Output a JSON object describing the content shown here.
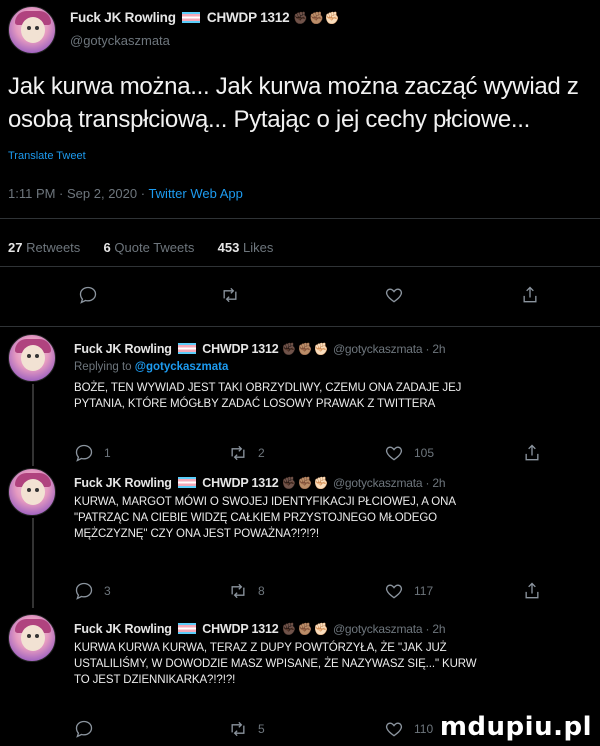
{
  "main_tweet": {
    "author_name": "Fuck JK Rowling",
    "author_suffix": "CHWDP 1312",
    "hands": "✊🏿✊🏽✊🏻",
    "handle": "@gotyckaszmata",
    "text_line1": "Jak kurwa można... Jak kurwa można zacząć wywiad z",
    "text_line2": "osobą transpłciową... Pytając o jej cechy płciowe...",
    "translate_label": "Translate Tweet",
    "timestamp": "1:11 PM · Sep 2, 2020 · ",
    "app": "Twitter Web App",
    "retweets_count": "27",
    "retweets_label": "Retweets",
    "quotes_count": "6",
    "quotes_label": "Quote Tweets",
    "likes_count": "453",
    "likes_label": "Likes"
  },
  "replies": [
    {
      "author_name": "Fuck JK Rowling",
      "author_suffix": "CHWDP 1312",
      "hands": "✊🏿✊🏽✊🏻",
      "handle_time": "@gotyckaszmata · 2h",
      "replying_prefix": "Replying to ",
      "replying_mention": "@gotyckaszmata",
      "line1": "BOŻE, TEN WYWIAD JEST TAKI OBRZYDLIWY, CZEMU ONA ZADAJE JEJ",
      "line2": "PYTANIA, KTÓRE MÓGŁBY ZADAĆ LOSOWY PRAWAK Z TWITTERA",
      "line3": "",
      "reply_count": "1",
      "retweet_count": "2",
      "like_count": "105"
    },
    {
      "author_name": "Fuck JK Rowling",
      "author_suffix": "CHWDP 1312",
      "hands": "✊🏿✊🏽✊🏻",
      "handle_time": "@gotyckaszmata · 2h",
      "line1": "KURWA, MARGOT MÓWI O SWOJEJ IDENTYFIKACJI PŁCIOWEJ, A ONA",
      "line2": "\"PATRZĄC NA CIEBIE WIDZĘ CAŁKIEM PRZYSTOJNEGO MŁODEGO",
      "line3": "MĘŻCZYZNĘ\" CZY ONA JEST POWAŻNA?!?!?!",
      "reply_count": "3",
      "retweet_count": "8",
      "like_count": "117"
    },
    {
      "author_name": "Fuck JK Rowling",
      "author_suffix": "CHWDP 1312",
      "hands": "✊🏿✊🏽✊🏻",
      "handle_time": "@gotyckaszmata · 2h",
      "line1": "KURWA KURWA KURWA, TERAZ Z DUPY POWTÓRZYŁA, ŻE \"JAK JUŻ",
      "line2": "USTALILIŚMY, W DOWODZIE MASZ WPISANE, ŻE NAZYWASZ SIĘ...\" KURW",
      "line3": "TO JEST DZIENNIKARKA?!?!?!",
      "reply_count": "",
      "retweet_count": "5",
      "like_count": "110"
    }
  ],
  "watermark": "mdupiu.pl",
  "icons": {
    "reply": "comment-icon",
    "retweet": "retweet-icon",
    "like": "heart-icon",
    "share": "share-icon"
  },
  "colors": {
    "background": "#000000",
    "link": "#1d9bf0",
    "muted": "#6e767d",
    "text": "#f2f2f2"
  }
}
